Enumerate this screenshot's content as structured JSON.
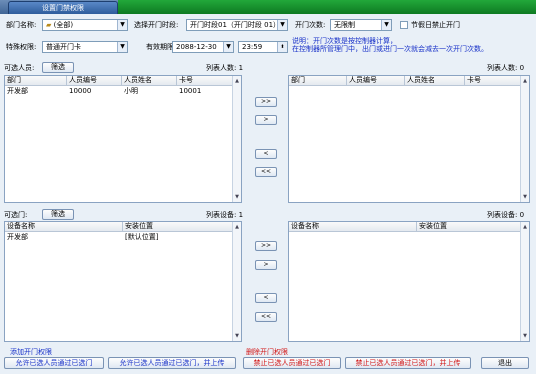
{
  "window": {
    "title_tab": "设置门禁权限"
  },
  "filters": {
    "department_label": "部门名称:",
    "department_value": "(全部)",
    "period_label": "选择开门时段:",
    "period_value": "开门时段01（开门时段 01）",
    "count_label": "开门次数:",
    "count_value": "无限制",
    "holiday_label": "节假日禁止开门",
    "special_label": "特殊权限:",
    "special_value": "普通开门卡",
    "expiry_label": "有效期限:",
    "expiry_date": "2088-12-30",
    "expiry_time": "23:59",
    "note_line1": "说明：开门次数是按控制器计算，",
    "note_line2": "在控制器所管理门中，出门或进门一次就会减去一次开门次数。"
  },
  "people": {
    "available_label": "可选人员:",
    "filter_btn": "筛选",
    "count_label_left": "列表人数: 1",
    "count_label_right": "列表人数: 0",
    "columns": [
      "部门",
      "人员编号",
      "人员姓名",
      "卡号"
    ],
    "rows": [
      [
        "开发部",
        "10000",
        "小明",
        "10001"
      ]
    ],
    "right_columns": [
      "部门",
      "人员编号",
      "人员姓名",
      "卡号"
    ]
  },
  "doors": {
    "available_label": "可选门:",
    "filter_btn": "筛选",
    "count_label_left": "列表设备: 1",
    "count_label_right": "列表设备: 0",
    "columns": [
      "设备名称",
      "安装位置"
    ],
    "rows": [
      [
        "开发部",
        "[默认位置]"
      ]
    ],
    "right_columns": [
      "设备名称",
      "安装位置"
    ]
  },
  "move_buttons": {
    "add_all": ">>",
    "add_one": ">",
    "remove_one": "<",
    "remove_all": "<<"
  },
  "footer": {
    "add_group_label": "添加开门权限",
    "delete_group_label": "删除开门权限",
    "allow_btn": "允许已选人员通过已选门",
    "allow_upload_btn": "允许已选人员通过已选门，并上传",
    "deny_btn": "禁止已选人员通过已选门",
    "deny_upload_btn": "禁止已选人员通过已选门，并上传",
    "exit_btn": "退出"
  },
  "colors": {
    "accent_green": "#159a2c",
    "note_blue": "#1730c8",
    "delete_red": "#d21313"
  }
}
